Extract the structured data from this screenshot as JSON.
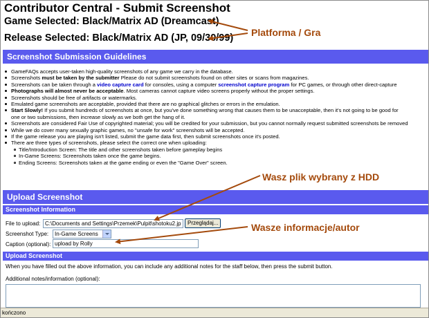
{
  "page": {
    "title": "Contributor Central - Submit Screenshot",
    "game_selected": "Game Selected: Black/Matrix AD (Dreamcast)",
    "release_selected": "Release Selected: Black/Matrix AD (JP, 09/30/99)"
  },
  "annotations": {
    "platform": "Platforma / Gra",
    "file": "Wasz plik wybrany z HDD",
    "info": "Wasze informacje/autor",
    "color": "#a44a0c"
  },
  "guidelines": {
    "header": "Screenshot Submission Guidelines",
    "items": [
      {
        "a": "GameFAQs accepts user-taken high-quality screenshots of any game we carry in the database."
      },
      {
        "a": "Screenshots ",
        "b": "must be taken by the submitter",
        "c": " Please do not submit screenshots found on other sites or scans from magazines."
      },
      {
        "a": "Screenshots can be taken through a ",
        "l1": "video capture card",
        "c": " for consoles, using a computer ",
        "l2": "screenshot capture program",
        "d": " for PC games, or through other direct-capture"
      },
      {
        "b": "Photographs will almost never be acceptable",
        "c": ". Most cameras cannot capture video screens properly without the proper settings."
      },
      {
        "a": "Screenshots should be free of artifacts or watermarks."
      },
      {
        "a": "Emulated game screenshots are acceptable, provided that there are no graphical glitches or errors in the emulation."
      },
      {
        "b": "Start Slowly!",
        "c": " If you submit hundreds of screenshots at once, but you've done something wrong that causes them to be unacceptable, then it's not going to be good for",
        "cont": "one or two submissions, then increase slowly as we both get the hang of it."
      },
      {
        "a": "Screenshots are considered Fair Use of copyrighted material; you will be credited for your submission, but you cannot normally request submitted screenshots be removed"
      },
      {
        "a": "While we do cover many sexually graphic games, no \"unsafe for work\" screenshots will be accepted."
      },
      {
        "a": "If the game release you are playing isn't listed, submit the game data first, then submit screenshots once it's posted."
      },
      {
        "a": "There are three types of screenshots, please select the correct one when uploading:"
      }
    ],
    "types": [
      "Title/Introduction Screen: The title and other screenshots taken before gameplay begins",
      "In-Game Screens: Screenshots taken once the game begins.",
      "Ending Screens: Screenshots taken at the game ending or even the \"Game Over\" screen."
    ]
  },
  "upload": {
    "header": "Upload Screenshot",
    "info_header": "Screenshot Information",
    "file_label": "File to upload:",
    "file_value": "C:\\Documents and Settings\\Przemek\\Pulpit\\shotoku2.jp",
    "browse_label": "Przeglądaj...",
    "type_label": "Screenshot Type:",
    "type_value": "In-Game Screens",
    "caption_label": "Caption (optional):",
    "caption_value": "upload by Rolly",
    "submit_header": "Upload Screenshot",
    "notes_text": "When you have filled out the above information, you can include any additional notes for the staff below, then press the submit button.",
    "notes_label": "Additional notes/information (optional):"
  },
  "status": {
    "text": "kończono"
  },
  "colors": {
    "bar": "#5a5aee",
    "link": "#0000cc"
  }
}
